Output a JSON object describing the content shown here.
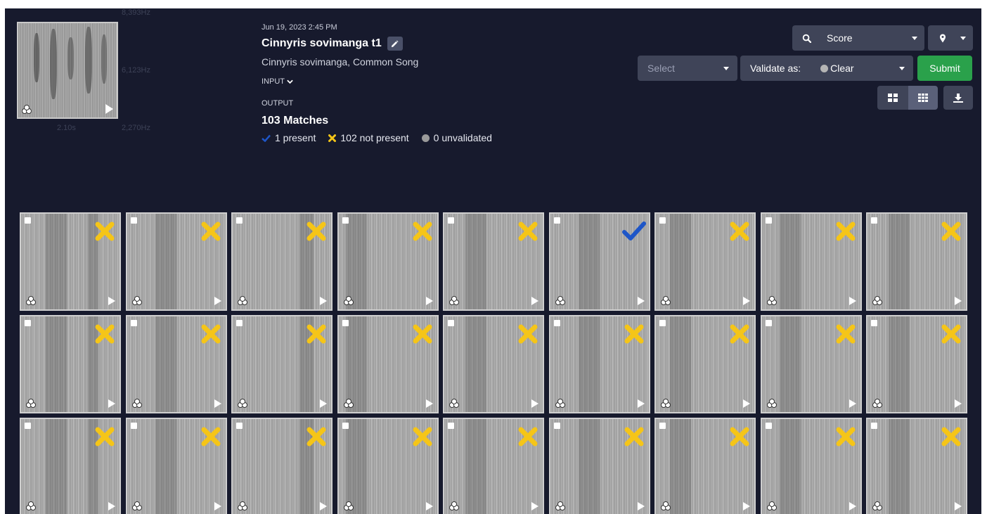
{
  "thumbnail": {
    "freq_top": "8,393Hz",
    "freq_mid": "6,123Hz",
    "freq_bottom": "2,270Hz",
    "duration": "2.10s"
  },
  "recording": {
    "date": "Jun 19, 2023 2:45 PM",
    "title": "Cinnyris sovimanga t1",
    "subtitle": "Cinnyris sovimanga, Common Song",
    "input_label": "INPUT",
    "output_label": "OUTPUT",
    "matches": "103 Matches",
    "present": "1 present",
    "not_present": "102 not present",
    "unvalidated": "0 unvalidated"
  },
  "toolbar": {
    "sort_label": "Score",
    "select_placeholder": "Select",
    "validate_label": "Validate as:",
    "validate_value": "Clear",
    "submit_label": "Submit"
  },
  "colors": {
    "background": "#171a2d",
    "present": "#1e56c8",
    "not_present": "#f5c518",
    "submit": "#2aa14b",
    "control": "#3f4458"
  },
  "results": [
    {
      "status": "not_present"
    },
    {
      "status": "not_present"
    },
    {
      "status": "not_present"
    },
    {
      "status": "not_present"
    },
    {
      "status": "not_present"
    },
    {
      "status": "present"
    },
    {
      "status": "not_present"
    },
    {
      "status": "not_present"
    },
    {
      "status": "not_present"
    },
    {
      "status": "not_present"
    },
    {
      "status": "not_present"
    },
    {
      "status": "not_present"
    },
    {
      "status": "not_present"
    },
    {
      "status": "not_present"
    },
    {
      "status": "not_present"
    },
    {
      "status": "not_present"
    },
    {
      "status": "not_present"
    },
    {
      "status": "not_present"
    },
    {
      "status": "not_present"
    },
    {
      "status": "not_present"
    },
    {
      "status": "not_present"
    },
    {
      "status": "not_present"
    },
    {
      "status": "not_present"
    },
    {
      "status": "not_present"
    },
    {
      "status": "not_present"
    },
    {
      "status": "not_present"
    },
    {
      "status": "not_present"
    }
  ]
}
